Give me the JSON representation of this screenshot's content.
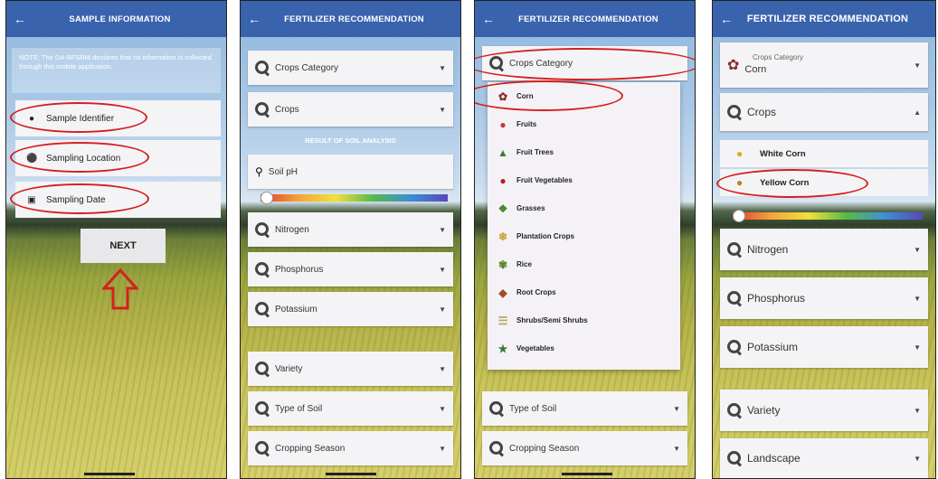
{
  "screens": {
    "sample_info": {
      "title": "SAMPLE INFORMATION",
      "note": "NOTE: The DA-BFSRM declares that no information is collected through this mobile application.",
      "fields": [
        "Sample Identifier",
        "Sampling Location",
        "Sampling Date"
      ],
      "next_label": "NEXT"
    },
    "fert_rec_1": {
      "title": "FERTILIZER RECOMMENDATION",
      "crops_category": "Crops Category",
      "crops": "Crops",
      "section_title": "RESULT OF SOIL ANALYSIS",
      "soil_ph": "Soil pH",
      "nitrogen": "Nitrogen",
      "phosphorus": "Phosphorus",
      "potassium": "Potassium",
      "variety": "Variety",
      "type_of_soil": "Type of Soil",
      "cropping_season": "Cropping Season"
    },
    "fert_rec_2": {
      "title": "FERTILIZER RECOMMENDATION",
      "crops_category": "Crops Category",
      "options": [
        {
          "label": "Corn",
          "icon": "corn-icon"
        },
        {
          "label": "Fruits",
          "icon": "fruits-icon"
        },
        {
          "label": "Fruit Trees",
          "icon": "fruit-trees-icon"
        },
        {
          "label": "Fruit Vegetables",
          "icon": "fruit-vegetables-icon"
        },
        {
          "label": "Grasses",
          "icon": "grasses-icon"
        },
        {
          "label": "Plantation Crops",
          "icon": "plantation-crops-icon"
        },
        {
          "label": "Rice",
          "icon": "rice-icon"
        },
        {
          "label": "Root Crops",
          "icon": "root-crops-icon"
        },
        {
          "label": "Shrubs/Semi Shrubs",
          "icon": "shrubs-icon"
        },
        {
          "label": "Vegetables",
          "icon": "vegetables-icon"
        }
      ],
      "type_of_soil": "Type of Soil",
      "cropping_season": "Cropping Season"
    },
    "fert_rec_3": {
      "title": "FERTILIZER RECOMMENDATION",
      "crops_category_label": "Crops Category",
      "crops_category_value": "Corn",
      "crops": "Crops",
      "sub_options": [
        "White Corn",
        "Yellow Corn"
      ],
      "nitrogen": "Nitrogen",
      "phosphorus": "Phosphorus",
      "potassium": "Potassium",
      "variety": "Variety",
      "landscape": "Landscape"
    }
  },
  "colors": {
    "topbar": "#3a63ad",
    "highlight_oval": "#d42020"
  }
}
